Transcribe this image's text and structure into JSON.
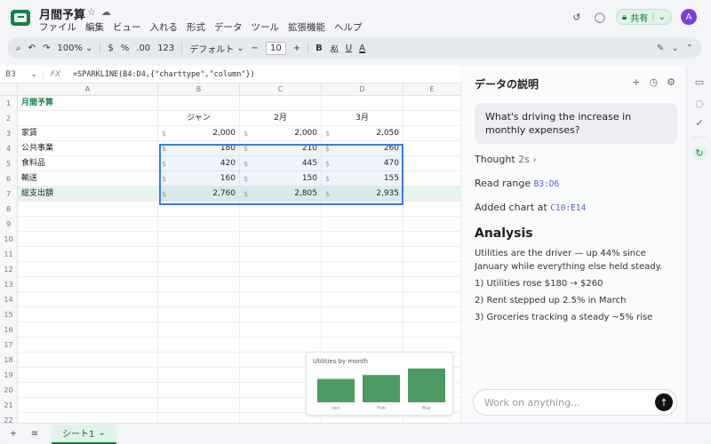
{
  "app": {
    "title": "月間予算",
    "menu": [
      "ファイル",
      "編集",
      "ビュー",
      "入れる",
      "形式",
      "データ",
      "ツール",
      "拡張機能",
      "ヘルプ"
    ],
    "share_label": "共有",
    "avatar_initial": "A",
    "accent": "#1a7f4b"
  },
  "toolbar": {
    "zoom": "100%",
    "currency": "$",
    "percent": "%",
    "decimals": ".00",
    "number_format": "123",
    "font": "デフォルト",
    "font_size": "10",
    "bold": "B",
    "italic": "私",
    "underline": "U",
    "text_color": "A"
  },
  "formula_bar": {
    "cell_ref": "B3",
    "fx": "FX",
    "formula": "=SPARKLINE(B4:D4,{\"charttype\",\"column\"})"
  },
  "grid": {
    "columns": [
      "A",
      "B",
      "C",
      "D",
      "E"
    ],
    "row_numbers": [
      "1",
      "2",
      "3",
      "4",
      "5",
      "6",
      "7",
      "8",
      "9",
      "10",
      "11",
      "12",
      "13",
      "14",
      "15",
      "16",
      "17",
      "18",
      "19",
      "20",
      "21",
      "22"
    ],
    "title": "月間予算",
    "month_headers": [
      "ジャン",
      "2月",
      "3月"
    ],
    "currency_symbol": "$",
    "rows": [
      {
        "label": "家賃",
        "values": [
          "2,000",
          "2,000",
          "2,050"
        ]
      },
      {
        "label": "公共事業",
        "values": [
          "180",
          "210",
          "260"
        ]
      },
      {
        "label": "食料品",
        "values": [
          "420",
          "445",
          "470"
        ]
      },
      {
        "label": "輸送",
        "values": [
          "160",
          "150",
          "155"
        ]
      }
    ],
    "total": {
      "label": "総支出額",
      "values": [
        "2,760",
        "2,805",
        "2,935"
      ]
    }
  },
  "mini_chart": {
    "title": "Utilities by month",
    "chart_data": {
      "type": "bar",
      "title": "Utilities by month",
      "categories": [
        "Jan",
        "Feb",
        "Mar"
      ],
      "values": [
        180,
        210,
        260
      ],
      "ylim": [
        0,
        260
      ],
      "color": "#4e9a64"
    }
  },
  "sheet_tab": {
    "name": "シート1"
  },
  "panel": {
    "title": "データの説明",
    "user_message": "What's driving the increase in monthly expenses?",
    "thought_label": "Thought",
    "thought_time": "2s",
    "read_range_label": "Read range",
    "read_range_value": "B3:D6",
    "added_chart_label": "Added chart at",
    "added_chart_value": "C10:E14",
    "analysis_heading": "Analysis",
    "analysis_intro": "Utilities are the driver — up 44% since January while everything else held steady.",
    "analysis_points": [
      "1) Utilities rose $180 → $260",
      "2) Rent stepped up 2.5% in March",
      "3) Groceries tracking a steady ~5% rise"
    ],
    "input_placeholder": "Work on anything..."
  }
}
